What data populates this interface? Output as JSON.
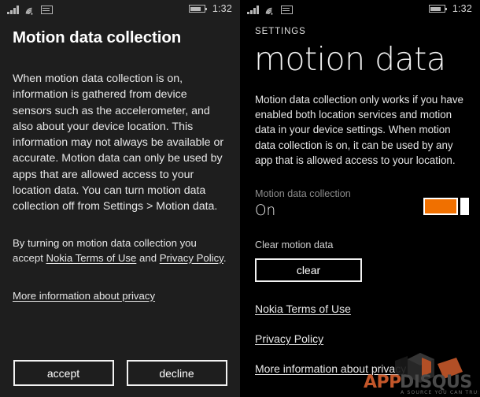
{
  "statusbar": {
    "signal_icon": "signal-bars-icon",
    "wifi_icon": "wifi-icon",
    "sim_icon": "sim-card-icon",
    "battery_icon": "battery-icon",
    "time": "1:32"
  },
  "left_screen": {
    "title": "Motion data collection",
    "body": "When motion data collection is on, information is gathered from device sensors such as the accelerometer, and also about your device location. This information may not always be available or accurate. Motion data can only be used by apps that are allowed access to your location data. You can turn motion data collection off from Settings > Motion data.",
    "consent_prefix": "By turning on motion data collection you accept ",
    "consent_link_terms": "Nokia Terms of Use",
    "consent_conjunction": " and ",
    "consent_link_privacy": "Privacy Policy",
    "consent_suffix": ".",
    "more_info_link": "More information about privacy",
    "accept_button": "accept",
    "decline_button": "decline"
  },
  "right_screen": {
    "app_name": "SETTINGS",
    "title": "motion data",
    "body": "Motion data collection only works if you have enabled both location services and motion data in your device settings. When motion data collection is on, it can be used by any app that is allowed access to your location.",
    "toggle_label": "Motion data collection",
    "toggle_value": "On",
    "toggle_state": "on",
    "toggle_color": "#f07000",
    "clear_label": "Clear motion data",
    "clear_button": "clear",
    "links": [
      "Nokia Terms of Use",
      "Privacy Policy",
      "More information about privacy"
    ]
  },
  "watermark": {
    "brand_app": "APP",
    "brand_disqus": "DISQUS",
    "tagline": "A SOURCE YOU CAN TRUST",
    "accent_color": "#c2562a"
  }
}
